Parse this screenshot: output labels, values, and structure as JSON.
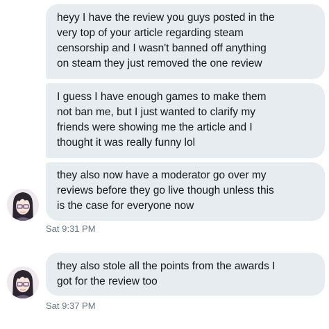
{
  "messages": [
    {
      "text": "heyy I have the review you guys posted in the\nvery top of your article regarding steam\ncensorship and I wasn't banned off anything\non steam they just removed the one review"
    },
    {
      "text": "I guess I have enough games to make them\nnot ban me, but I just wanted to clarify my\nfriends were showing me the article and I\nthought it was really funny lol"
    },
    {
      "text": "they also now have a moderator go over my\nreviews before they go live though unless this\nis the case for everyone now"
    },
    {
      "text": "they also stole all the points from the awards I\ngot for the review too"
    }
  ],
  "timestamps": [
    "Sat 9:31 PM",
    "Sat 9:37 PM"
  ],
  "colors": {
    "bubble_bg": "#e6ecf0",
    "text": "#14171a",
    "timestamp": "#657786"
  },
  "icons": {
    "avatar": "anime-character-avatar-icon"
  }
}
